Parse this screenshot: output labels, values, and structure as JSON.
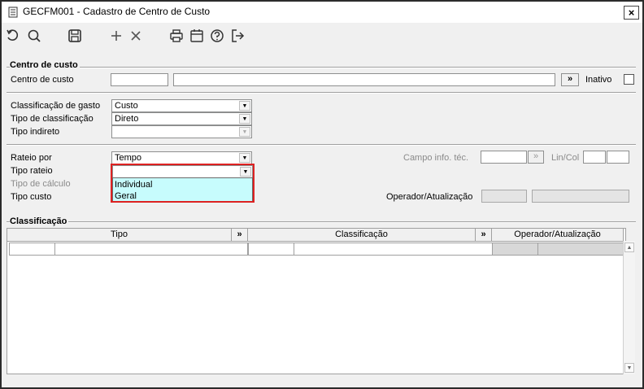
{
  "window": {
    "title": "GECFM001 - Cadastro de Centro de Custo",
    "close_label": "×"
  },
  "toolbar": {
    "icons": [
      "undo-icon",
      "search-icon",
      "save-icon",
      "add-icon",
      "delete-icon",
      "print-icon",
      "calendar-icon",
      "help-icon",
      "exit-icon"
    ]
  },
  "centro_custo": {
    "group_title": "Centro de custo",
    "label": "Centro de custo",
    "code_value": "",
    "description_value": "",
    "lookup_button": "»",
    "inativo_label": "Inativo"
  },
  "classificacao_gasto": {
    "label": "Classificação de gasto",
    "value": "Custo",
    "tipo_classificacao_label": "Tipo de classificação",
    "tipo_classificacao_value": "Direto",
    "tipo_indireto_label": "Tipo indireto",
    "tipo_indireto_value": ""
  },
  "rateio": {
    "rateio_por_label": "Rateio por",
    "rateio_por_value": "Tempo",
    "tipo_rateio_label": "Tipo rateio",
    "tipo_rateio_value": "",
    "tipo_rateio_options": [
      "Individual",
      "Geral"
    ],
    "tipo_calculo_label": "Tipo de cálculo",
    "tipo_custo_label": "Tipo custo",
    "campo_info_label": "Campo info. téc.",
    "lin_col_label": "Lin/Col",
    "operador_label": "Operador/Atualização"
  },
  "classificacao_grid": {
    "group_title": "Classificação",
    "columns": [
      "Tipo",
      "»",
      "Classificação",
      "»",
      "Operador/Atualização"
    ]
  }
}
